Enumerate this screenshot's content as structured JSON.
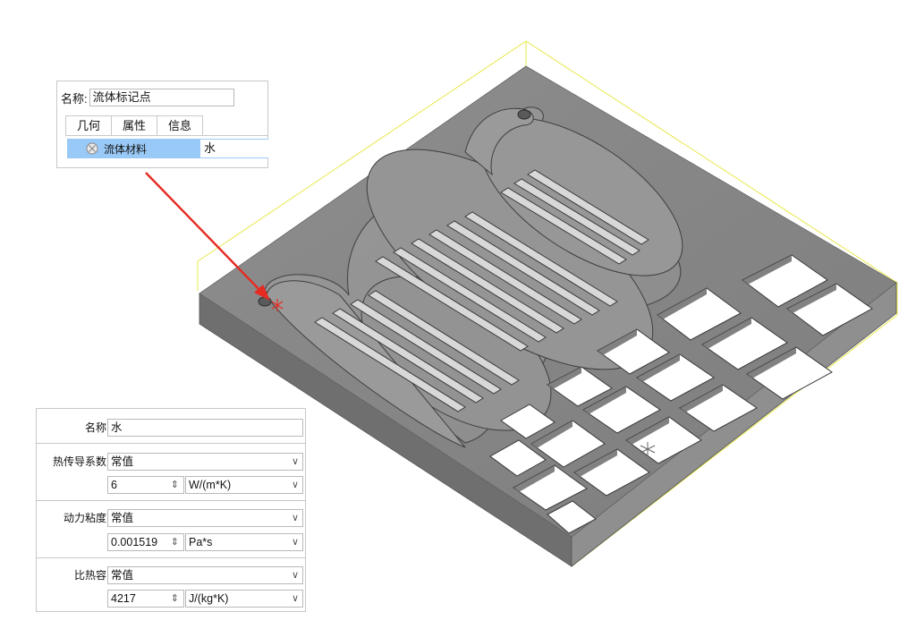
{
  "marker_panel": {
    "name_label": "名称:",
    "name_value": "流体标记点",
    "tabs": [
      {
        "label": "几何"
      },
      {
        "label": "属性"
      },
      {
        "label": "信息"
      }
    ],
    "material_row": {
      "icon": "material-ball-icon",
      "label": "流体材料",
      "value": "水"
    }
  },
  "material_panel": {
    "name_label": "名称",
    "name_value": "水",
    "properties": [
      {
        "label": "热传导系数",
        "mode": "常值",
        "value": "6",
        "unit": "W/(m*K)"
      },
      {
        "label": "动力粘度",
        "mode": "常值",
        "value": "0.001519",
        "unit": "Pa*s"
      },
      {
        "label": "比热容",
        "mode": "常值",
        "value": "4217",
        "unit": "J/(kg*K)"
      }
    ]
  },
  "model": {
    "description_icon": "cold-plate-3d-model",
    "highlight_color": "#e8e84a",
    "arrow_color": "#e52b22",
    "marker_color": "#e52b22"
  }
}
